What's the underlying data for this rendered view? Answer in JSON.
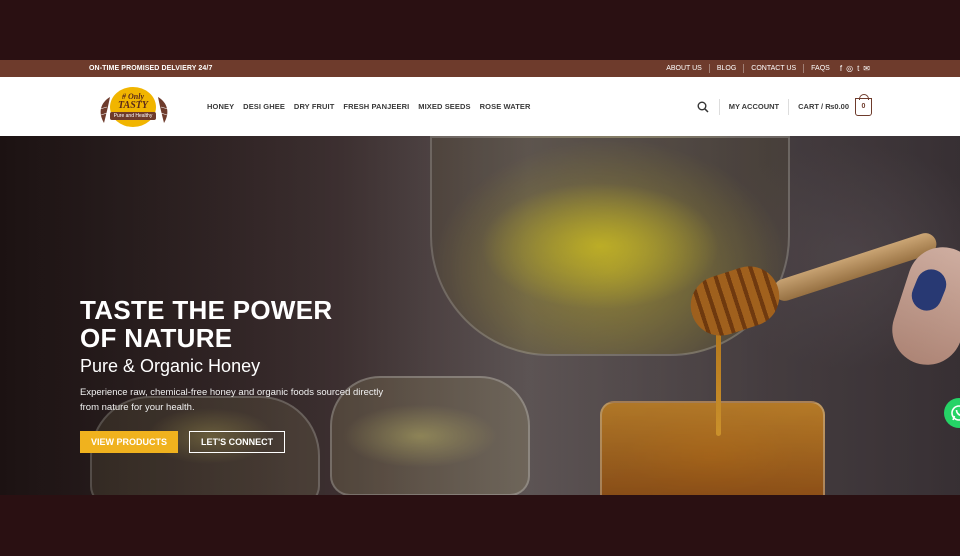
{
  "topbar": {
    "promo": "ON-TIME PROMISED DELVIERY 24/7",
    "links": [
      {
        "label": "ABOUT US"
      },
      {
        "label": "BLOG"
      },
      {
        "label": "CONTACT US"
      },
      {
        "label": "FAQS"
      }
    ],
    "social_icons": [
      "f",
      "◎",
      "t",
      "✉"
    ]
  },
  "header": {
    "logo": {
      "line1": "# Only",
      "line2": "TASTY",
      "ribbon": "Pure and Healthy"
    },
    "nav": [
      "HONEY",
      "DESI GHEE",
      "DRY FRUIT",
      "FRESH PANJEERI",
      "MIXED SEEDS",
      "ROSE WATER"
    ],
    "account": "MY ACCOUNT",
    "cart_label": "CART / ₨0.00",
    "cart_count": "0"
  },
  "hero": {
    "title_line1": "TASTE THE POWER",
    "title_line2": "OF NATURE",
    "subtitle": "Pure & Organic Honey",
    "description": "Experience raw, chemical-free honey and organic foods sourced directly from nature for your health.",
    "primary_button": "VIEW PRODUCTS",
    "secondary_button": "LET'S CONNECT"
  },
  "colors": {
    "topbar": "#6e3b2c",
    "accent": "#f0b21e",
    "outer_bg": "#2a1012",
    "whatsapp": "#25d366"
  }
}
